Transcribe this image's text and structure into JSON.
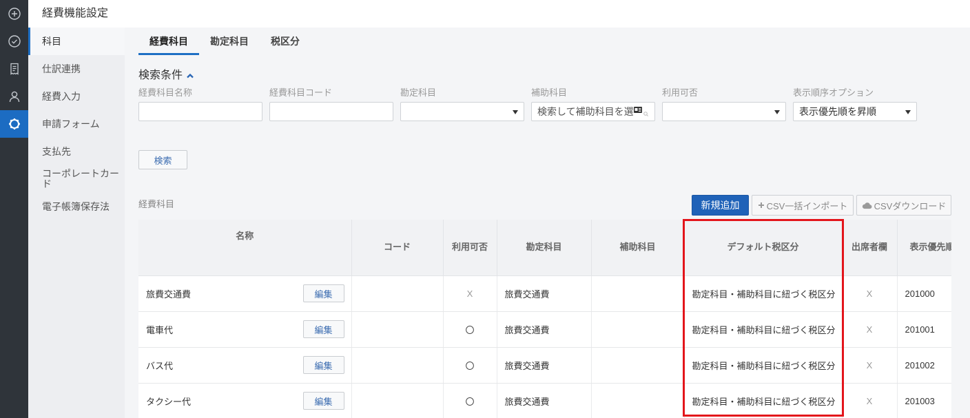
{
  "app": {
    "title": "経費機能設定"
  },
  "colors": {
    "rail": "#2f343a",
    "accent": "#1e6fc4",
    "primary_button": "#1f62b8",
    "link_text": "#3b6cb0",
    "highlight": "#e3151b"
  },
  "rail": {
    "items": [
      {
        "icon": "plus-circle-icon"
      },
      {
        "icon": "check-circle-icon"
      },
      {
        "icon": "receipt-icon"
      },
      {
        "icon": "user-icon"
      },
      {
        "icon": "gear-icon",
        "active": true
      }
    ]
  },
  "sidebar": {
    "items": [
      {
        "label": "科目",
        "active": true
      },
      {
        "label": "仕訳連携"
      },
      {
        "label": "経費入力"
      },
      {
        "label": "申請フォーム"
      },
      {
        "label": "支払先"
      },
      {
        "label": "コーポレートカード"
      },
      {
        "label": "電子帳簿保存法"
      }
    ]
  },
  "tabs": [
    {
      "label": "経費科目",
      "active": true
    },
    {
      "label": "勘定科目"
    },
    {
      "label": "税区分"
    }
  ],
  "search": {
    "title": "検索条件",
    "fields": [
      {
        "label": "経費科目名称",
        "value": ""
      },
      {
        "label": "経費科目コード",
        "value": ""
      },
      {
        "label": "勘定科目",
        "value": ""
      },
      {
        "label": "補助科目",
        "placeholder": "検索して補助科目を選"
      },
      {
        "label": "利用可否",
        "value": ""
      },
      {
        "label": "表示順序オプション",
        "value": "表示優先順を昇順"
      }
    ],
    "submit_label": "検索"
  },
  "list": {
    "section_label": "経費科目",
    "add_button": "新規追加",
    "import_button": "CSV一括インポート",
    "download_button": "CSVダウンロード",
    "edit_label": "編集",
    "columns": [
      "名称",
      "コード",
      "利用可否",
      "勘定科目",
      "補助科目",
      "デフォルト税区分",
      "出席者欄",
      "表示優先順"
    ],
    "rows": [
      {
        "name": "旅費交通費",
        "code": "",
        "available": "X",
        "account": "旅費交通費",
        "sub_account": "",
        "default_tax": "勘定科目・補助科目に紐づく税区分",
        "attendees": "X",
        "order": "201000"
      },
      {
        "name": "電車代",
        "code": "",
        "available": "〇",
        "account": "旅費交通費",
        "sub_account": "",
        "default_tax": "勘定科目・補助科目に紐づく税区分",
        "attendees": "X",
        "order": "201001"
      },
      {
        "name": "バス代",
        "code": "",
        "available": "〇",
        "account": "旅費交通費",
        "sub_account": "",
        "default_tax": "勘定科目・補助科目に紐づく税区分",
        "attendees": "X",
        "order": "201002"
      },
      {
        "name": "タクシー代",
        "code": "",
        "available": "〇",
        "account": "旅費交通費",
        "sub_account": "",
        "default_tax": "勘定科目・補助科目に紐づく税区分",
        "attendees": "X",
        "order": "201003"
      }
    ]
  }
}
